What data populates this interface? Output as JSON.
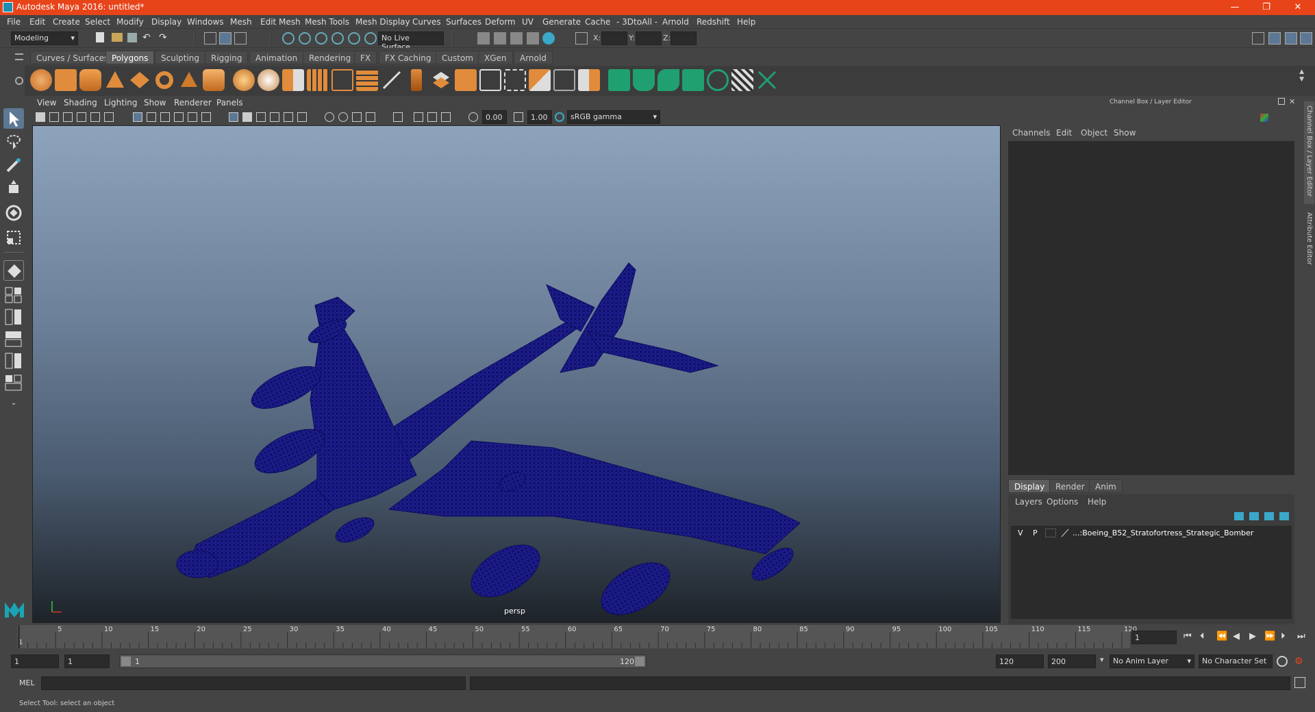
{
  "window": {
    "title": "Autodesk Maya 2016: untitled*",
    "controls": [
      "—",
      "❐",
      "✕"
    ]
  },
  "menubar": [
    "File",
    "Edit",
    "Create",
    "Select",
    "Modify",
    "Display",
    "Windows",
    "Mesh",
    "Edit Mesh",
    "Mesh Tools",
    "Mesh Display",
    "Curves",
    "Surfaces",
    "Deform",
    "UV",
    "Generate",
    "Cache",
    "- 3DtoAll -",
    "Arnold",
    "Redshift",
    "Help"
  ],
  "statusline": {
    "mode": "Modeling",
    "live_surface": "No Live Surface",
    "x_label": "X:",
    "y_label": "Y:",
    "z_label": "Z:"
  },
  "shelf": {
    "tabs": [
      "Curves / Surfaces",
      "Polygons",
      "Sculpting",
      "Rigging",
      "Animation",
      "Rendering",
      "FX",
      "FX Caching",
      "Custom",
      "XGen",
      "Arnold"
    ],
    "active_tab": "Polygons"
  },
  "viewport": {
    "menu": [
      "View",
      "Shading",
      "Lighting",
      "Show",
      "Renderer",
      "Panels"
    ],
    "exposure": "0.00",
    "gamma": "1.00",
    "color_space": "sRGB gamma",
    "camera_label": "persp",
    "wire_color": "#0d0d7a"
  },
  "right_panel": {
    "header": "Channel Box / Layer Editor",
    "channel_menu": [
      "Channels",
      "Edit",
      "Object",
      "Show"
    ],
    "layer_tabs": [
      "Display",
      "Render",
      "Anim"
    ],
    "active_layer_tab": "Display",
    "layer_menu": [
      "Layers",
      "Options",
      "Help"
    ],
    "layer_row": {
      "v": "V",
      "p": "P",
      "name": "...:Boeing_B52_Stratofortress_Strategic_Bomber"
    },
    "side_tabs": [
      "Channel Box / Layer Editor",
      "Attribute Editor"
    ]
  },
  "timeline": {
    "ticks": [
      "5",
      "10",
      "15",
      "20",
      "25",
      "30",
      "35",
      "40",
      "45",
      "50",
      "55",
      "60",
      "65",
      "70",
      "75",
      "80",
      "85",
      "90",
      "95",
      "100",
      "105",
      "110",
      "115",
      "120"
    ],
    "start_label": "1",
    "current_frame": "1"
  },
  "range": {
    "start": "1",
    "inner_start": "1",
    "slider_start": "1",
    "slider_end": "120",
    "end": "120",
    "max": "200",
    "anim_layer": "No Anim Layer",
    "character_set": "No Character Set"
  },
  "cmdline": {
    "label": "MEL"
  },
  "helpline": {
    "text": "Select Tool: select an object"
  }
}
